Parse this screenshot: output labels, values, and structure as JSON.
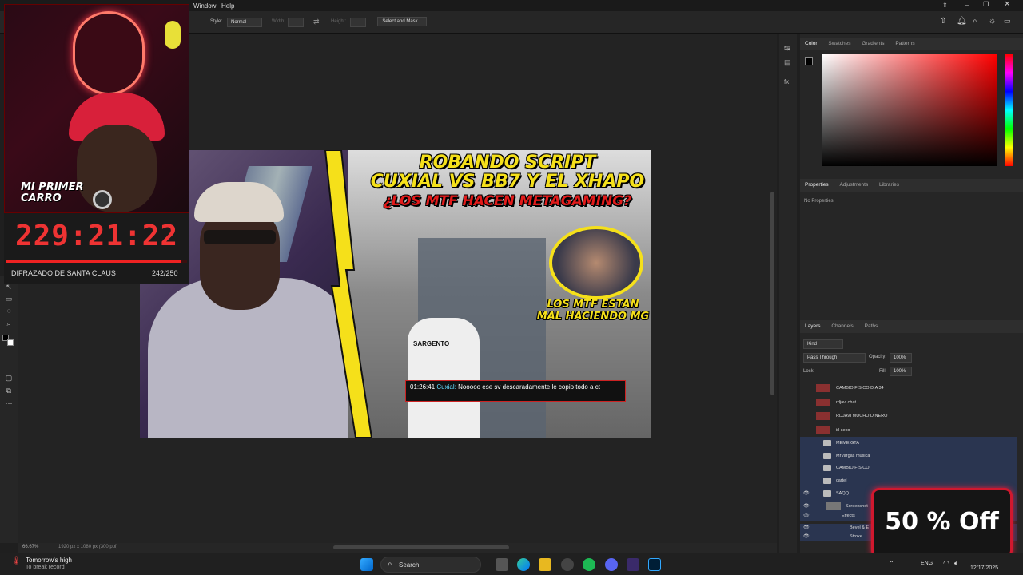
{
  "menu": {
    "window": "Window",
    "help": "Help"
  },
  "options": {
    "style_label": "Style:",
    "style_value": "Normal",
    "width_label": "Width:",
    "height_label": "Height:",
    "select_mask": "Select and Mask..."
  },
  "overlay": {
    "car_goal": "MI PRIMER CARRO",
    "timer": "229:21:22",
    "goal_name": "DIFRAZADO DE SANTA CLAUS",
    "goal_progress": "242/250",
    "goal_fraction": 0.968,
    "sale_badge": "50 %  Off"
  },
  "thumbnail": {
    "title_line1": "ROBANDO SCRIPT",
    "title_line2": "CUXIAL VS BB7 Y EL XHAPO",
    "title_line3": "¿LOS MTF HACEN METAGAMING?",
    "callout": "LOS MTF ESTAN MAL HACIENDO MG",
    "shirt_text": "SARGENTO",
    "chat_time": "01:26:41",
    "chat_user": "Cuxial:",
    "chat_msg": "Nooooo ese sv descaradamente le copio todo a ct"
  },
  "status": {
    "zoom": "66.67%",
    "docinfo": "1920 px x 1080 px (300 ppi)"
  },
  "color_panel": {
    "tabs": [
      "Color",
      "Swatches",
      "Gradients",
      "Patterns"
    ]
  },
  "properties_panel": {
    "tabs": [
      "Properties",
      "Adjustments",
      "Libraries"
    ],
    "empty": "No Properties"
  },
  "layers_panel": {
    "tabs": [
      "Layers",
      "Channels",
      "Paths"
    ],
    "kind": "Kind",
    "blend": "Pass Through",
    "opacity_label": "Opacity:",
    "opacity": "100%",
    "lock_label": "Lock:",
    "fill_label": "Fill:",
    "fill": "100%",
    "layers": [
      {
        "name": "CAMBIO FÍSICO DIA 34",
        "type": "image"
      },
      {
        "name": "rdjavi chat",
        "type": "image"
      },
      {
        "name": "RDJAVI MUCHO DINERO",
        "type": "image"
      },
      {
        "name": "irl sexo",
        "type": "image"
      },
      {
        "name": "MEME GTA",
        "type": "folder"
      },
      {
        "name": "MrVargas musica",
        "type": "folder"
      },
      {
        "name": "CAMBIO FÍSICO",
        "type": "folder"
      },
      {
        "name": "cartel",
        "type": "folder"
      },
      {
        "name": "SAQQ",
        "type": "folder"
      },
      {
        "name": "Screenshot",
        "type": "image"
      },
      {
        "name": "Effects",
        "type": "effect"
      },
      {
        "name": "Bevel & E",
        "type": "effect"
      },
      {
        "name": "Stroke",
        "type": "effect"
      }
    ]
  },
  "taskbar": {
    "weather_line1": "Tomorrow's high",
    "weather_line2": "To break record",
    "search": "Search",
    "lang": "ENG",
    "date": "12/17/2025"
  }
}
